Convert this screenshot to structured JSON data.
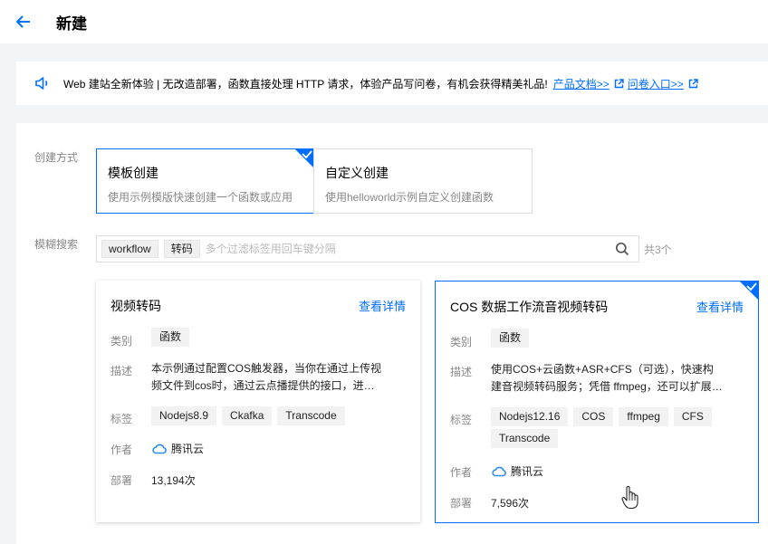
{
  "header": {
    "title": "新建"
  },
  "notice": {
    "text": "Web 建站全新体验 | 无改造部署，函数直接处理 HTTP 请求，体验产品写问卷，有机会获得精美礼品!",
    "link_docs": "产品文档>>",
    "link_survey": "问卷入口>>"
  },
  "create_method": {
    "label": "创建方式",
    "options": [
      {
        "title": "模板创建",
        "desc": "使用示例模版快速创建一个函数或应用",
        "selected": true
      },
      {
        "title": "自定义创建",
        "desc": "使用helloworld示例自定义创建函数",
        "selected": false
      }
    ]
  },
  "search": {
    "label": "模糊搜索",
    "tags": [
      "workflow",
      "转码"
    ],
    "placeholder": "多个过滤标签用回车键分隔",
    "count": "共3个"
  },
  "templates": [
    {
      "title": "视频转码",
      "detail": "查看详情",
      "category_label": "类别",
      "category": "函数",
      "desc_label": "描述",
      "desc": "本示例通过配置COS触发器，当你在通过上传视频文件到cos时，通过云点播提供的接口，进…",
      "tags_label": "标签",
      "tags": [
        "Nodejs8.9",
        "Ckafka",
        "Transcode"
      ],
      "author_label": "作者",
      "author": "腾讯云",
      "deploy_label": "部署",
      "deploy": "13,194次",
      "selected": false
    },
    {
      "title": "COS 数据工作流音视频转码",
      "detail": "查看详情",
      "category_label": "类别",
      "category": "函数",
      "desc_label": "描述",
      "desc": "使用COS+云函数+ASR+CFS（可选），快速构建音视频转码服务；凭借 ffmpeg，还可以扩展…",
      "tags_label": "标签",
      "tags": [
        "Nodejs12.16",
        "COS",
        "ffmpeg",
        "CFS",
        "Transcode"
      ],
      "author_label": "作者",
      "author": "腾讯云",
      "deploy_label": "部署",
      "deploy": "7,596次",
      "selected": true
    }
  ],
  "colors": {
    "accent": "#006eff",
    "cloud": "#2e8cf0"
  }
}
